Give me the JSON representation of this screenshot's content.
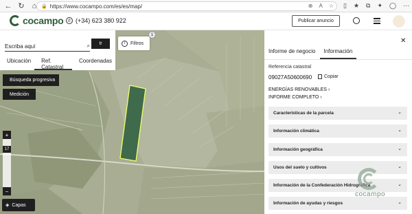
{
  "browser": {
    "url": "https://www.cocampo.com/es/es/map/"
  },
  "header": {
    "logo_text": "cocampo",
    "phone": "(+34) 623 380 922",
    "publish_label": "Publicar anuncio"
  },
  "search": {
    "placeholder": "Escriba aquí",
    "go_label": "Ir",
    "tabs": [
      "Ubicación",
      "Ref. Catastral",
      "Coordenadas"
    ]
  },
  "map": {
    "progressive_label": "Búsqueda progresiva",
    "measure_label": "Medición",
    "filters_label": "Filtros",
    "filters_count": "1",
    "zoom_in": "+",
    "zoom_level": "17",
    "zoom_out": "−",
    "layers_label": "Capas"
  },
  "sidebar": {
    "tabs": [
      "Informe de negocio",
      "Información"
    ],
    "ref_label": "Referencia catastral",
    "ref_value": "09027A50600690",
    "copy_label": "Copiar",
    "renewables_link": "ENERGÍAS RENOVABLES",
    "report_link": "INFORME COMPLETO",
    "sections": [
      "Características de la parcela",
      "Información climática",
      "Información geográfica",
      "Usos del suelo y cultivos",
      "Información de la Confederación Hidrográfica",
      "Información de ayudas y riesgos"
    ],
    "watermark_text": "cocampo"
  }
}
